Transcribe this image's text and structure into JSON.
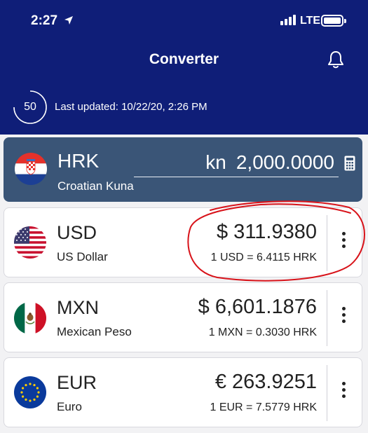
{
  "status_bar": {
    "time": "2:27",
    "network": "LTE"
  },
  "header": {
    "title": "Converter",
    "countdown": "50",
    "last_updated": "Last updated: 10/22/20, 2:26 PM"
  },
  "base": {
    "code": "HRK",
    "name": "Croatian Kuna",
    "symbol": "kn",
    "amount": "2,000.0000"
  },
  "rows": [
    {
      "code": "USD",
      "name": "US Dollar",
      "amount": "$ 311.9380",
      "rate": "1 USD = 6.4115 HRK"
    },
    {
      "code": "MXN",
      "name": "Mexican Peso",
      "amount": "$ 6,601.1876",
      "rate": "1 MXN = 0.3030 HRK"
    },
    {
      "code": "EUR",
      "name": "Euro",
      "amount": "€ 263.9251",
      "rate": "1 EUR = 7.5779 HRK"
    }
  ],
  "colors": {
    "header": "#0f1e78",
    "base_card": "#3a5577",
    "annotation": "#d8131a"
  }
}
